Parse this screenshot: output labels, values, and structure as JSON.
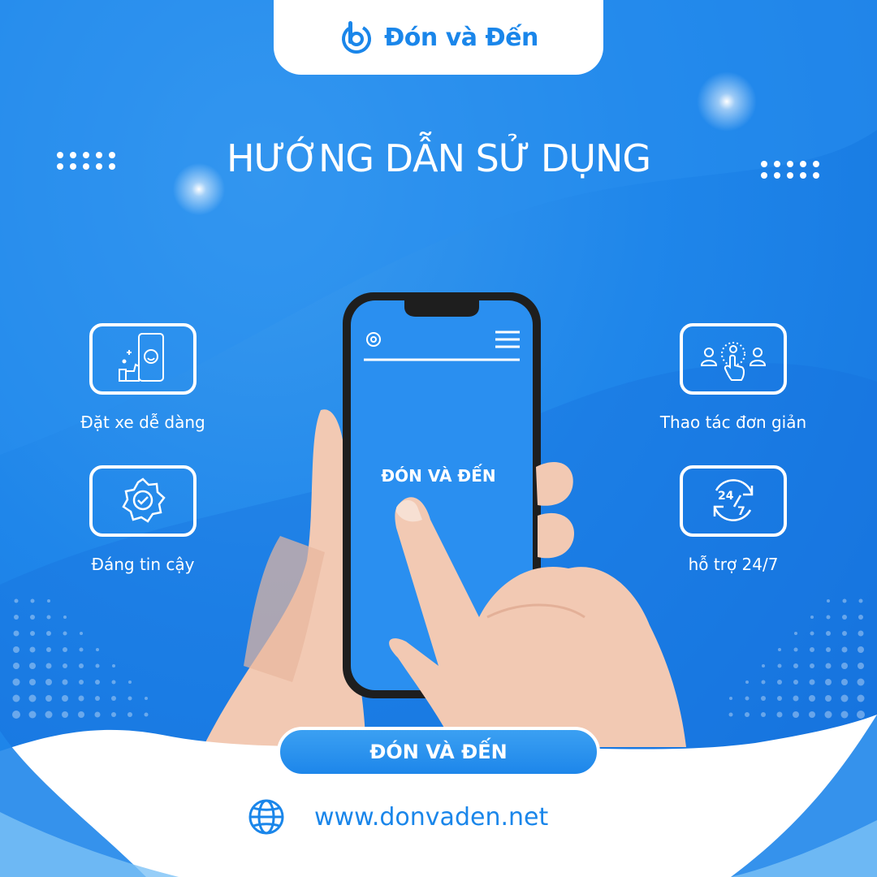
{
  "brand": {
    "name": "Đón và Đến",
    "logo_icon": "b-circle-logo-icon"
  },
  "title": "HƯỚNG DẪN SỬ DỤNG",
  "features": [
    {
      "label": "Đặt xe dễ dàng",
      "icon": "phone-booking-icon"
    },
    {
      "label": "Thao tác đơn giản",
      "icon": "tap-select-icon"
    },
    {
      "label": "Đáng tin cậy",
      "icon": "verified-badge-icon"
    },
    {
      "label": "hỗ trợ 24/7",
      "icon": "support-24-7-icon"
    }
  ],
  "phone": {
    "screen_text": "ĐÓN VÀ ĐẾN",
    "icons": [
      "search-icon",
      "menu-icon"
    ]
  },
  "cta_label": "ĐÓN VÀ ĐẾN",
  "website": {
    "url": "www.donvaden.net",
    "icon": "globe-icon"
  },
  "colors": {
    "primary": "#1f86ea",
    "dark_blue": "#1473dd",
    "white": "#ffffff"
  }
}
